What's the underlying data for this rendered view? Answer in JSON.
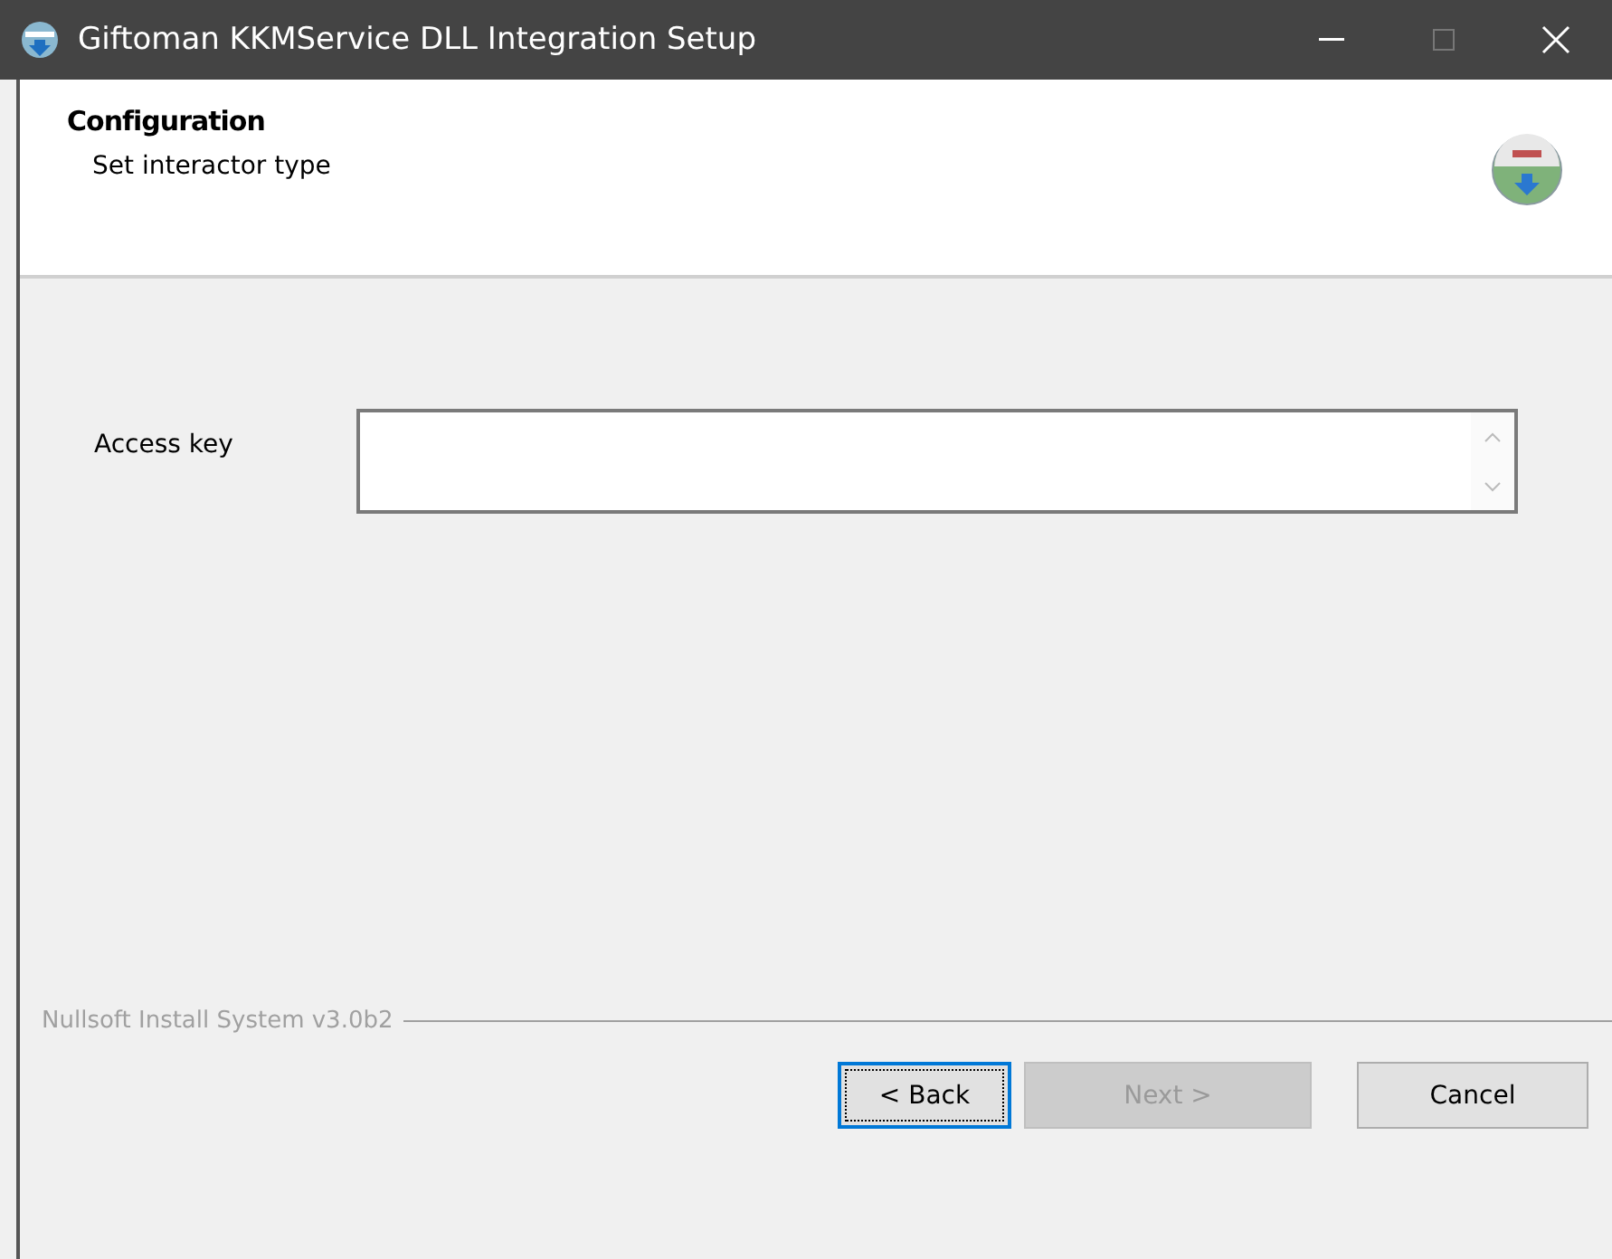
{
  "window": {
    "title": "Giftoman KKMService DLL Integration Setup"
  },
  "header": {
    "title": "Configuration",
    "subtitle": "Set interactor type"
  },
  "form": {
    "label": "Access key"
  },
  "footer": {
    "brand": "Nullsoft Install System v3.0b2"
  },
  "buttons": [
    {
      "label": "< Back",
      "disabled": false,
      "focused": true
    },
    {
      "label": "Next >",
      "disabled": true,
      "focused": false
    },
    {
      "label": "Cancel",
      "disabled": false,
      "focused": false
    }
  ]
}
